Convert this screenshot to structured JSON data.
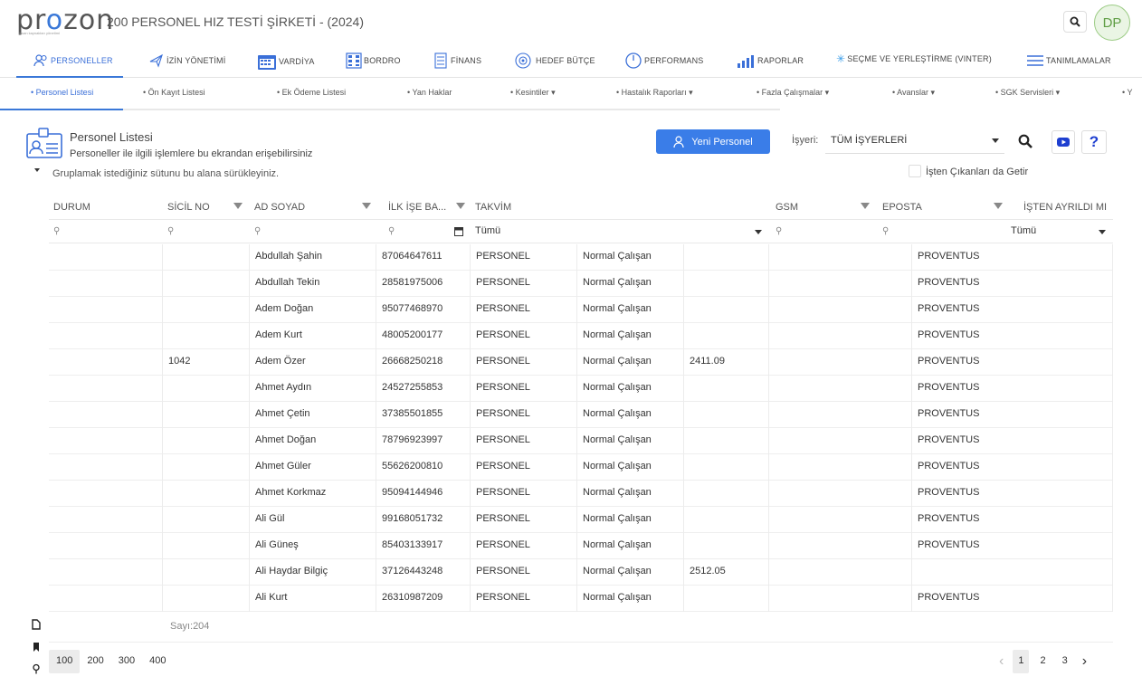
{
  "header": {
    "logo_text": "prozon",
    "logo_subtext": "insan kaynakları yönetimi",
    "title": "200 PERSONEL HIZ TESTİ ŞİRKETİ - (2024)",
    "avatar_initials": "DP"
  },
  "main_nav": [
    {
      "label": "PERSONELLER",
      "icon": "people-icon",
      "active": true
    },
    {
      "label": "İZİN YÖNETİMİ",
      "icon": "plane-icon",
      "active": false
    },
    {
      "label": "VARDİYA",
      "icon": "calendar-icon",
      "active": false
    },
    {
      "label": "BORDRO",
      "icon": "payroll-icon",
      "active": false
    },
    {
      "label": "FİNANS",
      "icon": "finance-icon",
      "active": false
    },
    {
      "label": "HEDEF BÜTÇE",
      "icon": "target-icon",
      "active": false
    },
    {
      "label": "PERFORMANS",
      "icon": "gauge-icon",
      "active": false
    },
    {
      "label": "RAPORLAR",
      "icon": "chart-icon",
      "active": false
    },
    {
      "label": "SEÇME VE YERLEŞTİRME (VINTER)",
      "icon": "snowflake-icon",
      "active": false
    },
    {
      "label": "TANIMLAMALAR",
      "icon": "menu-icon",
      "active": false
    }
  ],
  "sub_nav": [
    {
      "label": "Personel Listesi",
      "active": true
    },
    {
      "label": "Ön Kayıt Listesi"
    },
    {
      "label": "Ek Ödeme Listesi"
    },
    {
      "label": "Yan Haklar"
    },
    {
      "label": "Kesintiler ▾"
    },
    {
      "label": "Hastalık Raporları ▾"
    },
    {
      "label": "Fazla Çalışmalar ▾"
    },
    {
      "label": "Avanslar ▾"
    },
    {
      "label": "SGK Servisleri ▾"
    },
    {
      "label": "Y"
    }
  ],
  "page": {
    "title": "Personel Listesi",
    "subtitle": "Personeller ile ilgili işlemlere bu ekrandan erişebilirsiniz",
    "new_button": "Yeni Personel",
    "isyeri_label": "İşyeri:",
    "isyeri_value": "TÜM İŞYERLERİ",
    "checkbox_label": "İşten Çıkanları da Getir",
    "group_hint": "Gruplamak istediğiniz sütunu bu alana sürükleyiniz."
  },
  "grid": {
    "headers": [
      "DURUM",
      "SİCİL NO",
      "AD SOYAD",
      "İLK İŞE BA...",
      "TAKVİM",
      "GSM",
      "EPOSTA",
      "İŞTEN AYRILDI MI"
    ],
    "filter_takvim": "Tümü",
    "filter_ayrildi": "Tümü",
    "rows": [
      {
        "durum": "",
        "sicil": "",
        "ad": "Abdullah Şahin",
        "tc": "87064647611",
        "takvim": "PERSONEL",
        "tip": "Normal Çalışan",
        "extra": "",
        "gsm": "",
        "eposta": "PROVENTUS"
      },
      {
        "durum": "",
        "sicil": "",
        "ad": "Abdullah Tekin",
        "tc": "28581975006",
        "takvim": "PERSONEL",
        "tip": "Normal Çalışan",
        "extra": "",
        "gsm": "",
        "eposta": "PROVENTUS"
      },
      {
        "durum": "",
        "sicil": "",
        "ad": "Adem Doğan",
        "tc": "95077468970",
        "takvim": "PERSONEL",
        "tip": "Normal Çalışan",
        "extra": "",
        "gsm": "",
        "eposta": "PROVENTUS"
      },
      {
        "durum": "",
        "sicil": "",
        "ad": "Adem Kurt",
        "tc": "48005200177",
        "takvim": "PERSONEL",
        "tip": "Normal Çalışan",
        "extra": "",
        "gsm": "",
        "eposta": "PROVENTUS"
      },
      {
        "durum": "",
        "sicil": "1042",
        "ad": "Adem Özer",
        "tc": "26668250218",
        "takvim": "PERSONEL",
        "tip": "Normal Çalışan",
        "extra": "2411.09",
        "gsm": "",
        "eposta": "PROVENTUS"
      },
      {
        "durum": "",
        "sicil": "",
        "ad": "Ahmet Aydın",
        "tc": "24527255853",
        "takvim": "PERSONEL",
        "tip": "Normal Çalışan",
        "extra": "",
        "gsm": "",
        "eposta": "PROVENTUS"
      },
      {
        "durum": "",
        "sicil": "",
        "ad": "Ahmet Çetin",
        "tc": "37385501855",
        "takvim": "PERSONEL",
        "tip": "Normal Çalışan",
        "extra": "",
        "gsm": "",
        "eposta": "PROVENTUS"
      },
      {
        "durum": "",
        "sicil": "",
        "ad": "Ahmet Doğan",
        "tc": "78796923997",
        "takvim": "PERSONEL",
        "tip": "Normal Çalışan",
        "extra": "",
        "gsm": "",
        "eposta": "PROVENTUS"
      },
      {
        "durum": "",
        "sicil": "",
        "ad": "Ahmet Güler",
        "tc": "55626200810",
        "takvim": "PERSONEL",
        "tip": "Normal Çalışan",
        "extra": "",
        "gsm": "",
        "eposta": "PROVENTUS"
      },
      {
        "durum": "",
        "sicil": "",
        "ad": "Ahmet Korkmaz",
        "tc": "95094144946",
        "takvim": "PERSONEL",
        "tip": "Normal Çalışan",
        "extra": "",
        "gsm": "",
        "eposta": "PROVENTUS"
      },
      {
        "durum": "",
        "sicil": "",
        "ad": "Ali Gül",
        "tc": "99168051732",
        "takvim": "PERSONEL",
        "tip": "Normal Çalışan",
        "extra": "",
        "gsm": "",
        "eposta": "PROVENTUS"
      },
      {
        "durum": "",
        "sicil": "",
        "ad": "Ali Güneş",
        "tc": "85403133917",
        "takvim": "PERSONEL",
        "tip": "Normal Çalışan",
        "extra": "",
        "gsm": "",
        "eposta": "PROVENTUS"
      },
      {
        "durum": "",
        "sicil": "",
        "ad": "Ali Haydar Bilgiç",
        "tc": "37126443248",
        "takvim": "PERSONEL",
        "tip": "Normal Çalışan",
        "extra": "2512.05",
        "gsm": "",
        "eposta": ""
      },
      {
        "durum": "",
        "sicil": "",
        "ad": "Ali Kurt",
        "tc": "26310987209",
        "takvim": "PERSONEL",
        "tip": "Normal Çalışan",
        "extra": "",
        "gsm": "",
        "eposta": "PROVENTUS"
      }
    ],
    "count_text": "Sayı:204"
  },
  "pager": {
    "sizes": [
      "100",
      "200",
      "300",
      "400"
    ],
    "active_size": "100",
    "pages": [
      "1",
      "2",
      "3"
    ],
    "active_page": "1"
  },
  "colors": {
    "accent": "#3a7de8",
    "help": "#1e3fd0",
    "avatar_green": "#5f9d44"
  }
}
